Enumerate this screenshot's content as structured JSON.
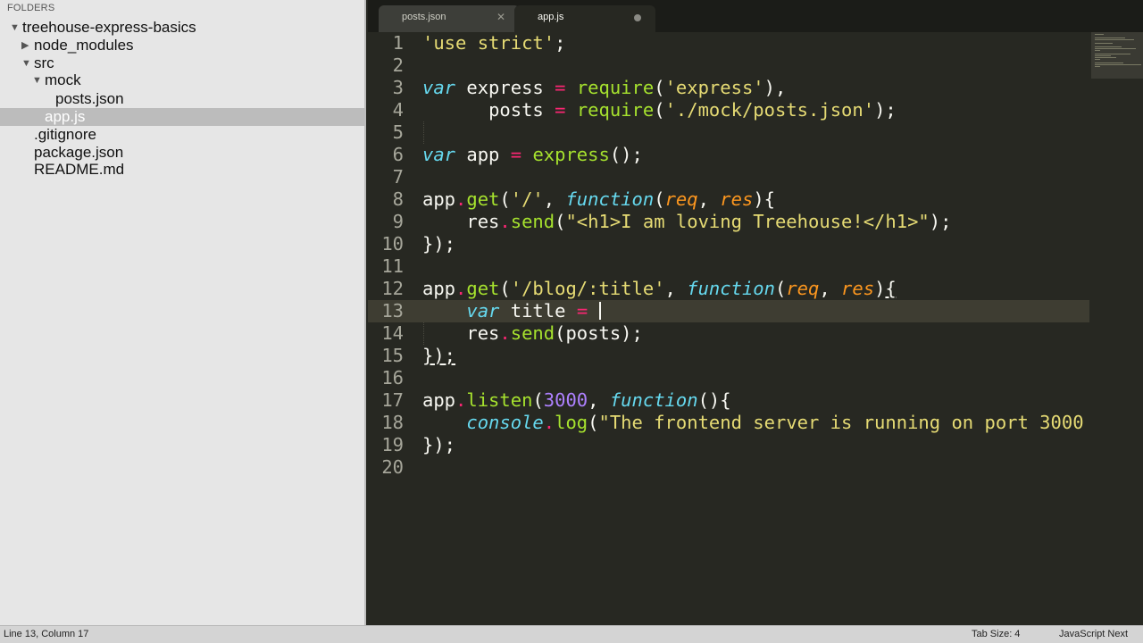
{
  "sidebar": {
    "header": "FOLDERS",
    "root": "treehouse-express-basics",
    "node_modules": "node_modules",
    "src": "src",
    "mock": "mock",
    "posts_json": "posts.json",
    "app_js": "app.js",
    "gitignore": ".gitignore",
    "package_json": "package.json",
    "readme": "README.md"
  },
  "tabs": [
    {
      "label": "posts.json",
      "active": false,
      "dirty": false
    },
    {
      "label": "app.js",
      "active": true,
      "dirty": true
    }
  ],
  "editor": {
    "active_line": 13,
    "line_numbers": [
      "1",
      "2",
      "3",
      "4",
      "5",
      "6",
      "7",
      "8",
      "9",
      "10",
      "11",
      "12",
      "13",
      "14",
      "15",
      "16",
      "17",
      "18",
      "19",
      "20"
    ],
    "tokens": {
      "l1": [
        "'use strict'",
        ";"
      ],
      "l3": [
        "var",
        "express",
        "=",
        "require",
        "(",
        "'express'",
        "),"
      ],
      "l4": [
        "posts",
        "=",
        "require",
        "(",
        "'./mock/posts.json'",
        ");"
      ],
      "l6": [
        "var",
        "app",
        "=",
        "express",
        "();"
      ],
      "l8": [
        "app",
        ".",
        "get",
        "(",
        "'/'",
        ",",
        "function",
        "(",
        "req",
        ", ",
        "res",
        "){"
      ],
      "l9": [
        "res",
        ".",
        "send",
        "(",
        "\"<h1>I am loving Treehouse!</h1>\"",
        ");"
      ],
      "l10": [
        "});"
      ],
      "l12": [
        "app",
        ".",
        "get",
        "(",
        "'/blog/:title'",
        ",",
        "function",
        "(",
        "req",
        ", ",
        "res",
        ")",
        "{"
      ],
      "l13": [
        "var",
        "title",
        "="
      ],
      "l14": [
        "res",
        ".",
        "send",
        "(posts);"
      ],
      "l15": [
        "});"
      ],
      "l17": [
        "app",
        ".",
        "listen",
        "(",
        "3000",
        ",",
        "function",
        "(){"
      ],
      "l18": [
        "console",
        ".",
        "log",
        "(",
        "\"The frontend server is running on port 3000"
      ],
      "l19": [
        "});"
      ]
    }
  },
  "status": {
    "position": "Line 13, Column 17",
    "tab_size": "Tab Size: 4",
    "syntax": "JavaScript Next"
  },
  "colors": {
    "editor_bg": "#272822",
    "sidebar_bg": "#e6e6e6",
    "keyword": "#66d9ef",
    "operator": "#f92672",
    "function": "#a6e22e",
    "string": "#e6db74",
    "number": "#ae81ff",
    "parameter": "#fd971f"
  },
  "icons": {
    "expanded": "triangle-down-icon",
    "collapsed": "triangle-right-icon",
    "close": "close-icon",
    "dirty": "unsaved-dot-icon"
  }
}
